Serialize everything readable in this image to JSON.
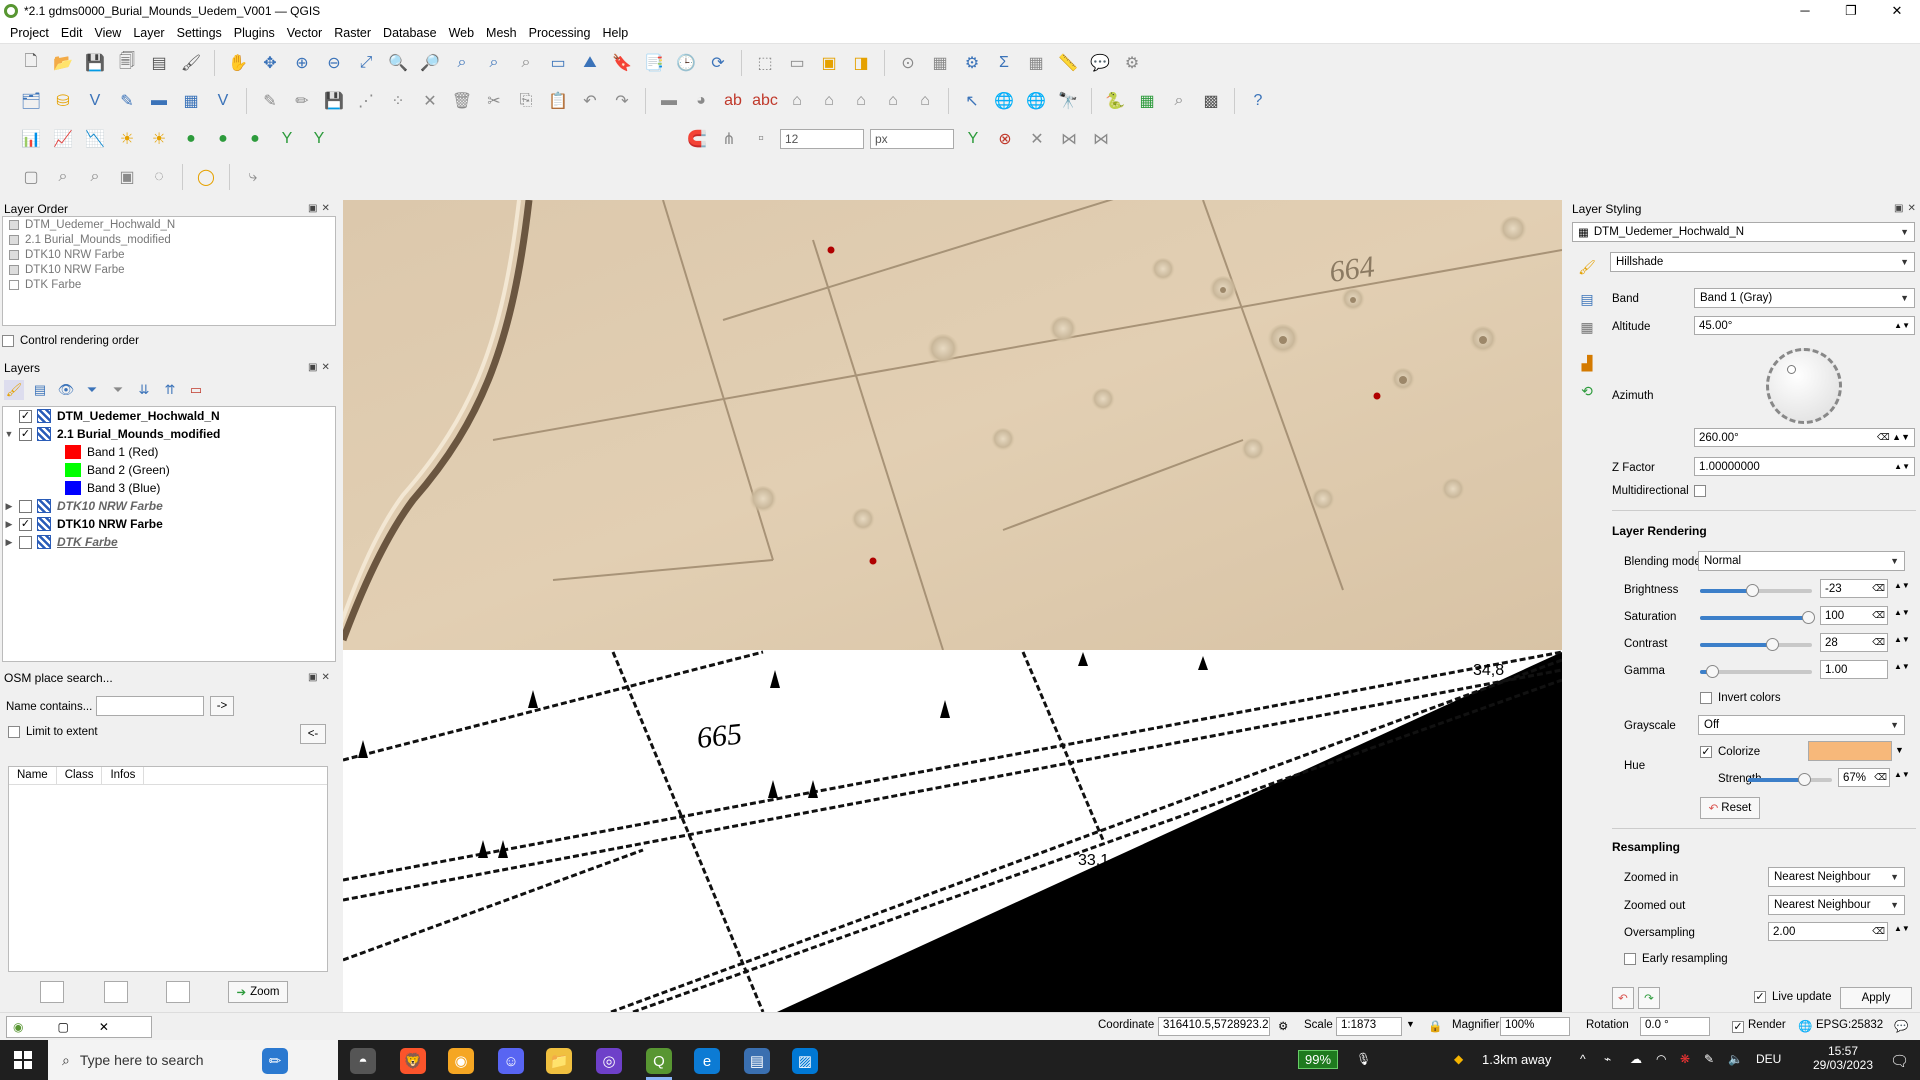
{
  "window": {
    "title": "*2.1 gdms0000_Burial_Mounds_Uedem_V001 — QGIS",
    "controls": [
      "─",
      "❐",
      "✕"
    ]
  },
  "menu": [
    "Project",
    "Edit",
    "View",
    "Layer",
    "Settings",
    "Plugins",
    "Vector",
    "Raster",
    "Database",
    "Web",
    "Mesh",
    "Processing",
    "Help"
  ],
  "toolbar3": {
    "size_value": "12",
    "unit_value": "px"
  },
  "layer_order": {
    "title": "Layer Order",
    "items": [
      "DTM_Uedemer_Hochwald_N",
      "2.1 Burial_Mounds_modified",
      "DTK10 NRW Farbe",
      "DTK10 NRW Farbe",
      "DTK Farbe"
    ],
    "control_rendering_label": "Control rendering order"
  },
  "layers": {
    "title": "Layers",
    "items": [
      {
        "name": "DTM_Uedemer_Hochwald_N"
      },
      {
        "name": "2.1 Burial_Mounds_modified"
      },
      {
        "name": "Band 1 (Red)",
        "color": "#ff0000"
      },
      {
        "name": "Band 2 (Green)",
        "color": "#00ff00"
      },
      {
        "name": "Band 3 (Blue)",
        "color": "#0000ff"
      },
      {
        "name": "DTK10 NRW Farbe"
      },
      {
        "name": "DTK10 NRW Farbe"
      },
      {
        "name": "DTK Farbe"
      }
    ]
  },
  "osm": {
    "title": "OSM place search...",
    "name_label": "Name contains...",
    "go_label": "->",
    "limit_label": "Limit to extent",
    "back_label": "<-",
    "columns": [
      "Name",
      "Class",
      "Infos"
    ],
    "zoom_label": "Zoom"
  },
  "map": {
    "labels": [
      "664",
      "665",
      "34,8",
      "33,1"
    ]
  },
  "styling": {
    "title": "Layer Styling",
    "layer": "DTM_Uedemer_Hochwald_N",
    "renderer": "Hillshade",
    "band_label": "Band",
    "band_value": "Band 1 (Gray)",
    "altitude_label": "Altitude",
    "altitude_value": "45.00°",
    "azimuth_label": "Azimuth",
    "azimuth_value": "260.00°",
    "zfactor_label": "Z Factor",
    "zfactor_value": "1.00000000",
    "multidirectional_label": "Multidirectional",
    "layer_rendering_title": "Layer Rendering",
    "blending_label": "Blending mode",
    "blending_value": "Normal",
    "brightness_label": "Brightness",
    "brightness_value": "-23",
    "saturation_label": "Saturation",
    "saturation_value": "100",
    "contrast_label": "Contrast",
    "contrast_value": "28",
    "gamma_label": "Gamma",
    "gamma_value": "1.00",
    "invert_label": "Invert colors",
    "grayscale_label": "Grayscale",
    "grayscale_value": "Off",
    "hue_label": "Hue",
    "colorize_label": "Colorize",
    "colorize_color": "#f7b87a",
    "strength_label": "Strength",
    "strength_value": "67%",
    "reset_label": "Reset",
    "resampling_title": "Resampling",
    "zoomed_in_label": "Zoomed in",
    "zoomed_in_value": "Nearest Neighbour",
    "zoomed_out_label": "Zoomed out",
    "zoomed_out_value": "Nearest Neighbour",
    "oversampling_label": "Oversampling",
    "oversampling_value": "2.00",
    "early_label": "Early resampling",
    "live_update_label": "Live update",
    "apply_label": "Apply"
  },
  "statusbar": {
    "coordinate_label": "Coordinate",
    "coordinate_value": "316410.5,5728923.2",
    "scale_label": "Scale",
    "scale_value": "1:1873",
    "magnifier_label": "Magnifier",
    "magnifier_value": "100%",
    "rotation_label": "Rotation",
    "rotation_value": "0.0 °",
    "render_label": "Render",
    "crs": "EPSG:25832"
  },
  "taskbar": {
    "search_placeholder": "Type here to search",
    "battery": "99%",
    "weather": "1.3km away",
    "lang": "DEU",
    "time": "15:57",
    "date": "29/03/2023"
  }
}
